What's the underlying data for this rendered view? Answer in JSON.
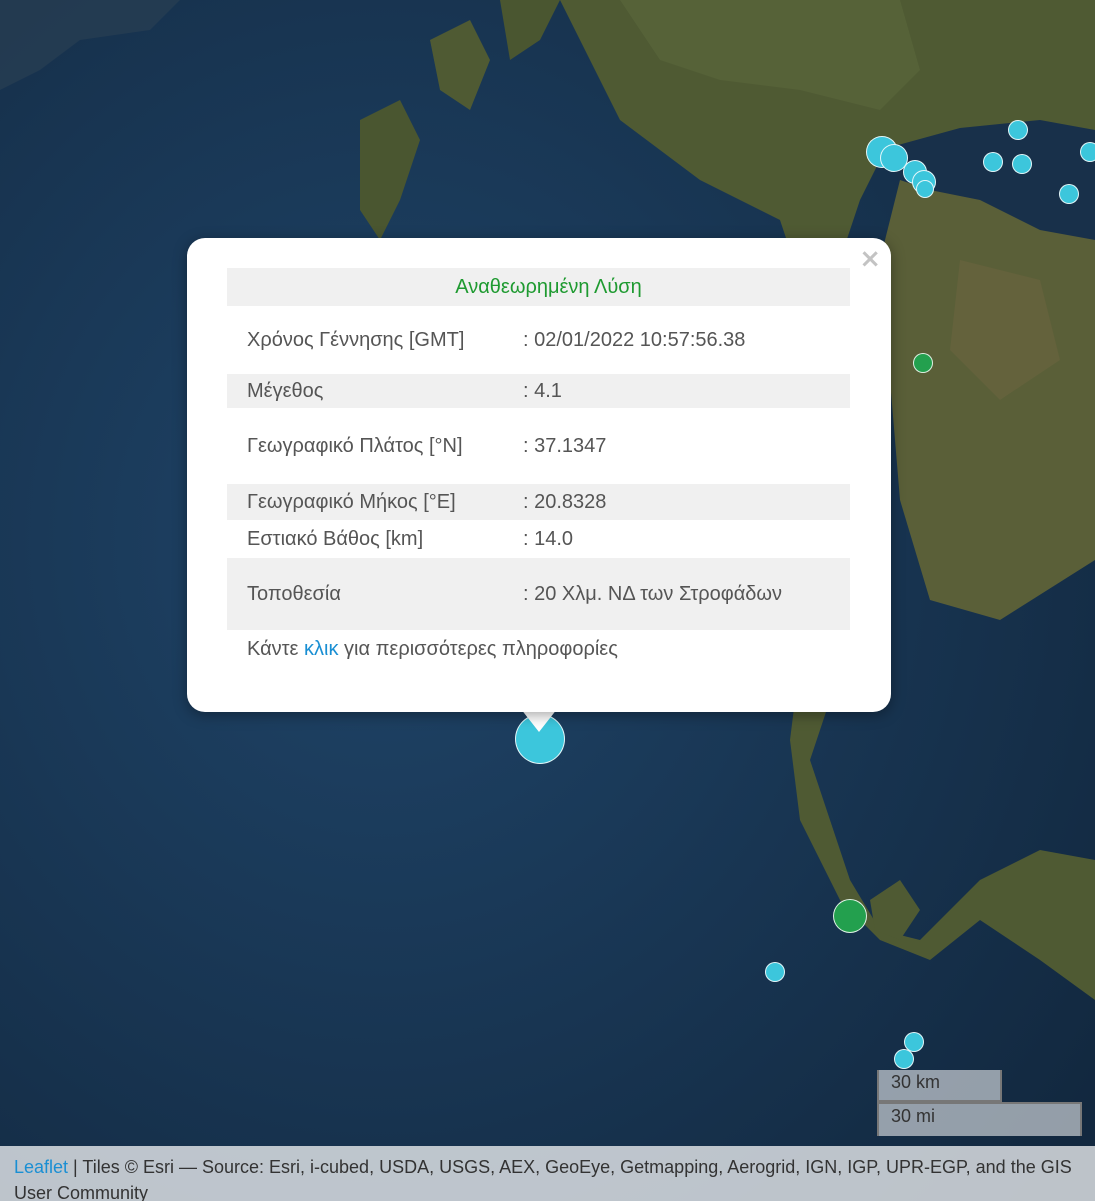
{
  "popup": {
    "title": "Αναθεωρημένη Λύση",
    "rows": [
      {
        "label": "Χρόνος Γέννησης [GMT]",
        "value": ": 02/01/2022 10:57:56.38"
      },
      {
        "label": "Μέγεθος",
        "value": ": 4.1"
      },
      {
        "label": "Γεωγραφικό Πλάτος [°N]",
        "value": ": 37.1347"
      },
      {
        "label": "Γεωγραφικό Μήκος [°E]",
        "value": ": 20.8328"
      },
      {
        "label": "Εστιακό Βάθος [km]",
        "value": ": 14.0"
      },
      {
        "label": "Τοποθεσία",
        "value": ": 20 Χλμ. ΝΔ των Στροφάδων"
      }
    ],
    "more_prefix": "Κάντε ",
    "more_link": "κλικ",
    "more_suffix": " για περισσότερες πληροφορίες",
    "close_glyph": "×"
  },
  "scale": {
    "km": "30 km",
    "mi": "30 mi"
  },
  "attribution": {
    "leaflet_link": "Leaflet",
    "text": " | Tiles © Esri — Source: Esri, i-cubed, USDA, USGS, AEX, GeoEye, Getmapping, Aerogrid, IGN, IGP, UPR-EGP, and the GIS User Community"
  },
  "colors": {
    "marker_cyan": "#3cc6dc",
    "marker_green": "#23a04e",
    "title_green": "#1e9a30",
    "link_blue": "#1a8fd3",
    "sea": "#16304f",
    "land": "#4f5a33"
  }
}
